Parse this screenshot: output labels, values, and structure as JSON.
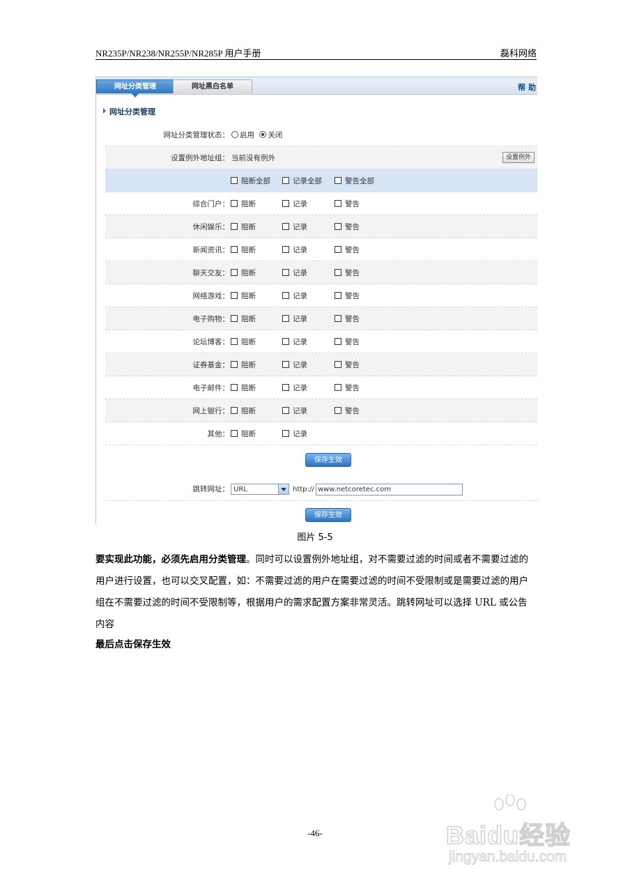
{
  "header": {
    "left": "NR235P/NR238/NR255P/NR285P 用户手册",
    "right": "磊科网络"
  },
  "tabs": [
    {
      "label": "网址分类管理"
    },
    {
      "label": "网址黑白名单"
    }
  ],
  "help_label": "帮 助",
  "section_title": "网址分类管理",
  "status": {
    "label": "网址分类管理状态：",
    "opt_on": "启用",
    "opt_off": "关闭",
    "selected": "关闭"
  },
  "exception": {
    "label": "设置例外地址组：",
    "value": "当前没有例外",
    "button": "设置例外"
  },
  "all_row": {
    "block": "阻断全部",
    "log": "记录全部",
    "warn": "警告全部"
  },
  "option_labels": {
    "block": "阻断",
    "log": "记录",
    "warn": "警告"
  },
  "categories": [
    {
      "name": "综合门户："
    },
    {
      "name": "休闲娱乐："
    },
    {
      "name": "新闻资讯："
    },
    {
      "name": "聊天交友："
    },
    {
      "name": "网络游戏："
    },
    {
      "name": "电子购物："
    },
    {
      "name": "论坛博客："
    },
    {
      "name": "证券基金："
    },
    {
      "name": "电子邮件："
    },
    {
      "name": "网上银行："
    },
    {
      "name": "其他："
    }
  ],
  "save_label": "保存生效",
  "redirect": {
    "label": "跳转网址：",
    "select_value": "URL",
    "protocol": "http://",
    "url": "www.netcoretec.com"
  },
  "caption": "图片 5-5",
  "body": {
    "bold_lead": "要实现此功能，必须先启用分类管理",
    "rest": "。同时可以设置例外地址组，对不需要过滤的时间或者不需要过滤的用户进行设置，也可以交叉配置，如：不需要过滤的用户在需要过滤的时间不受限制或是需要过滤的用户组在不需要过滤的时间不受限制等，根据用户的需求配置方案非常灵活。跳转网址可以选择 URL 或公告内容"
  },
  "final_line": "最后点击保存生效",
  "page_number": "-46-",
  "watermark": {
    "logo": "Baidu经验",
    "site": "jingyan.baidu.com"
  }
}
